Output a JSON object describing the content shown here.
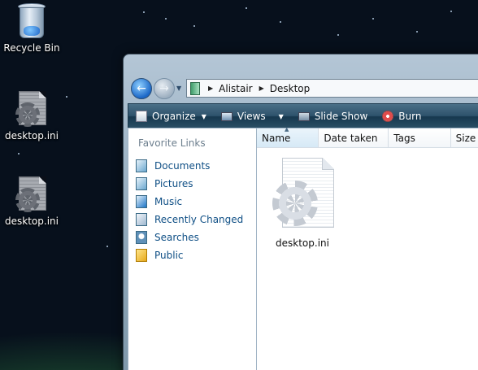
{
  "desktop": {
    "icons": [
      {
        "label": "Recycle Bin",
        "icon": "recycle-bin-icon"
      },
      {
        "label": "desktop.ini",
        "icon": "settings-file-icon"
      },
      {
        "label": "desktop.ini",
        "icon": "settings-file-icon"
      }
    ]
  },
  "explorer": {
    "address": {
      "crumbs": [
        "Alistair",
        "Desktop"
      ]
    },
    "toolbar": {
      "organize": "Organize",
      "views": "Views",
      "slideshow": "Slide Show",
      "burn": "Burn"
    },
    "favorites": {
      "title": "Favorite Links",
      "items": [
        {
          "label": "Documents",
          "icon": "documents-icon"
        },
        {
          "label": "Pictures",
          "icon": "pictures-icon"
        },
        {
          "label": "Music",
          "icon": "music-icon"
        },
        {
          "label": "Recently Changed",
          "icon": "recent-icon"
        },
        {
          "label": "Searches",
          "icon": "searches-icon"
        },
        {
          "label": "Public",
          "icon": "public-folder-icon"
        }
      ]
    },
    "columns": [
      "Name",
      "Date taken",
      "Tags",
      "Size"
    ],
    "files": [
      {
        "label": "desktop.ini",
        "icon": "settings-file-icon"
      }
    ]
  },
  "colors": {
    "link": "#0f4f85",
    "toolbar": "#2e536c"
  }
}
